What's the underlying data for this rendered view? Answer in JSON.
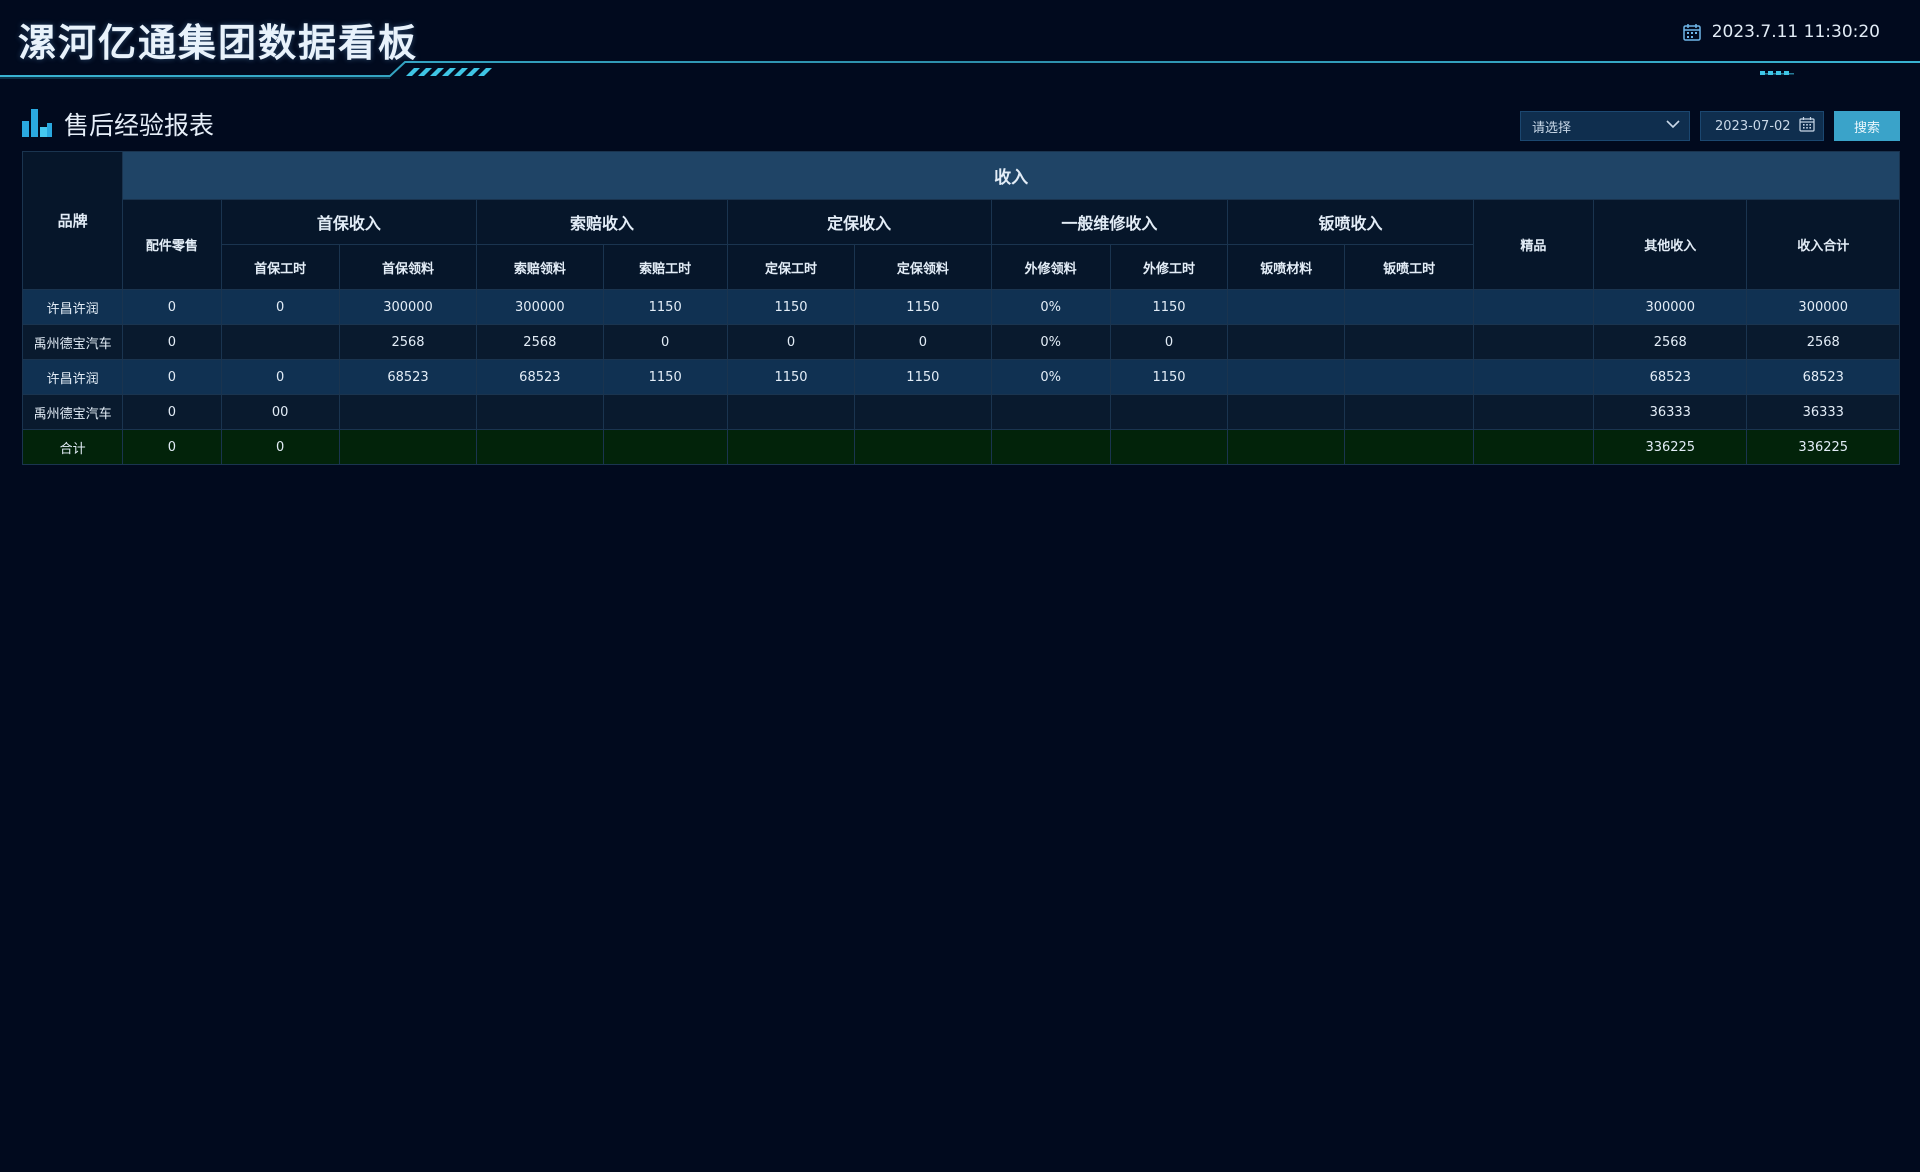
{
  "header": {
    "title": "漯河亿通集团数据看板",
    "datetime": "2023.7.11 11:30:20"
  },
  "section": {
    "title": "售后经验报表"
  },
  "filters": {
    "select_placeholder": "请选择",
    "date_value": "2023-07-02",
    "search_label": "搜索"
  },
  "colors": {
    "background": "#010a1e",
    "accent": "#3fc6e6",
    "header_band": "#1f4466",
    "row_odd": "#103152",
    "row_even": "#091a2e",
    "total_row": "#02230a",
    "button": "#3aa3c9"
  },
  "table": {
    "brand_header": "品牌",
    "income_header": "收入",
    "columns": {
      "parts_retail": "配件零售",
      "first_guarantee": "首保收入",
      "claim": "索赔收入",
      "regular": "定保收入",
      "general_repair": "一般维修收入",
      "sheet_spray": "钣喷收入",
      "boutique": "精品",
      "other": "其他收入",
      "total": "收入合计"
    },
    "subcolumns": {
      "first_labor": "首保工时",
      "first_material": "首保领料",
      "claim_material": "索赔领料",
      "claim_labor": "索赔工时",
      "regular_labor": "定保工时",
      "regular_material": "定保领料",
      "out_material": "外修领料",
      "out_labor": "外修工时",
      "spray_material": "钣喷材料",
      "spray_labor": "钣喷工时"
    },
    "rows": [
      [
        "许昌许润",
        "0",
        "0",
        "300000",
        "300000",
        "1150",
        "1150",
        "1150",
        "0%",
        "1150",
        "",
        "",
        "",
        "300000",
        "300000"
      ],
      [
        "禹州德宝汽车",
        "0",
        "",
        "2568",
        "2568",
        "0",
        "0",
        "0",
        "0%",
        "0",
        "",
        "",
        "",
        "2568",
        "2568"
      ],
      [
        "许昌许润",
        "0",
        "0",
        "68523",
        "68523",
        "1150",
        "1150",
        "1150",
        "0%",
        "1150",
        "",
        "",
        "",
        "68523",
        "68523"
      ],
      [
        "禹州德宝汽车",
        "0",
        "00",
        "",
        "",
        "",
        "",
        "",
        "",
        "",
        "",
        "",
        "",
        "36333",
        "36333"
      ],
      [
        "合计",
        "0",
        "0",
        "",
        "",
        "",
        "",
        "",
        "",
        "",
        "",
        "",
        "",
        "336225",
        "336225"
      ]
    ]
  }
}
